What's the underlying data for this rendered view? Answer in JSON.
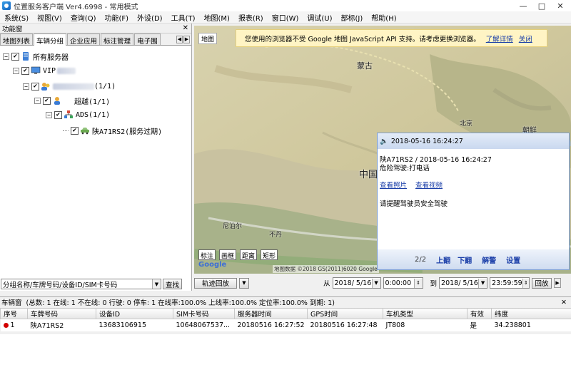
{
  "window": {
    "title": "位置服务客户端 Ver4.6998 - 常用模式"
  },
  "menu": [
    "系统(S)",
    "视图(V)",
    "查询(Q)",
    "功能(F)",
    "外设(D)",
    "工具(T)",
    "地图(M)",
    "报表(R)",
    "窗口(W)",
    "调试(U)",
    "部标(J)",
    "帮助(H)"
  ],
  "left_panel": {
    "title": "功能窗",
    "tabs": [
      "地图列表",
      "车辆分组",
      "企业应用",
      "标注管理",
      "电子围"
    ],
    "active_tab": 1,
    "tree": {
      "root": "所有服务器",
      "server": "VIP",
      "company_suffix": "(1/1)",
      "group1": "超越(1/1)",
      "group2": "ADS(1/1)",
      "vehicle": "陕A71RS2(服务过期)"
    },
    "search": {
      "placeholder": "分组名称/车牌号码/设备ID/SIM卡号码",
      "button": "查找"
    }
  },
  "map": {
    "tab_map": "地图",
    "warning": {
      "text": "您使用的浏览器不受 Google 地图 JavaScript API 支持。请考虑更换浏览器。",
      "link": "了解详情",
      "close": "关闭"
    },
    "labels": {
      "mongolia": "蒙古",
      "china": "中国",
      "nepal": "尼泊尔",
      "beijing": "北京",
      "korea": "朝鲜",
      "india": "不丹"
    },
    "tools": [
      "标注",
      "画框",
      "距离",
      "矩形"
    ],
    "logo": "Google",
    "copyright": "地图数据 ©2018 GS(2011)6020 Google"
  },
  "popup": {
    "header": "2018-05-16 16:24:27",
    "line1": "陕A71RS2 / 2018-05-16 16:24:27",
    "line2": "危险驾驶:打电话",
    "link_photo": "查看照片",
    "link_video": "查看视频",
    "message": "请提醒驾驶员安全驾驶",
    "page": "2/2",
    "actions": [
      "上翻",
      "下翻",
      "解警",
      "设置"
    ]
  },
  "playback": {
    "button": "轨迹回放",
    "from_label": "从",
    "from_date": "2018/ 5/16",
    "from_time": "0:00:00",
    "to_label": "到",
    "to_date": "2018/ 5/16",
    "to_time": "23:59:59",
    "play_button": "回放"
  },
  "vehicle_grid": {
    "title": "车辆窗",
    "summary": "(总数: 1 在线: 1 不在线: 0 行驶: 0 停车: 1 在线率:100.0% 上线率:100.0% 定位率:100.0% 到期: 1)",
    "columns": [
      "序号",
      "车牌号码",
      "设备ID",
      "SIM卡号码",
      "服务器时间",
      "GPS时间",
      "车机类型",
      "有效",
      "纬度"
    ],
    "rows": [
      [
        "1",
        "陕A71RS2",
        "13683106915",
        "10648067537...",
        "20180516 16:27:52",
        "20180516 16:27:48",
        "JT808",
        "是",
        "34.238801"
      ]
    ]
  },
  "colors": {
    "status_dot": "#d20000",
    "link": "#1a3ea8",
    "popup_bar": "#c9d8ef"
  }
}
